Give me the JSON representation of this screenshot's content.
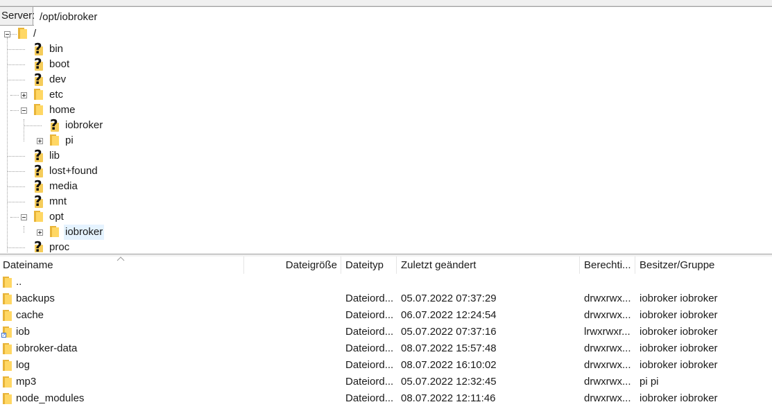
{
  "pathbar": {
    "label": "Server:",
    "value": "/opt/iobroker"
  },
  "tree": {
    "root": "/",
    "nodes": {
      "bin": "bin",
      "boot": "boot",
      "dev": "dev",
      "etc": "etc",
      "home": "home",
      "home_iobroker": "iobroker",
      "home_pi": "pi",
      "lib": "lib",
      "lost_found": "lost+found",
      "media": "media",
      "mnt": "mnt",
      "opt": "opt",
      "opt_iobroker": "iobroker",
      "proc": "proc"
    }
  },
  "list": {
    "columns": {
      "name": "Dateiname",
      "size": "Dateigröße",
      "type": "Dateityp",
      "modified": "Zuletzt geändert",
      "perms": "Berechti...",
      "owner": "Besitzer/Gruppe"
    },
    "rows": [
      {
        "name": "..",
        "size": "",
        "type": "",
        "modified": "",
        "perms": "",
        "owner": ""
      },
      {
        "name": "backups",
        "size": "",
        "type": "Dateiord...",
        "modified": "05.07.2022 07:37:29",
        "perms": "drwxrwx...",
        "owner": "iobroker iobroker"
      },
      {
        "name": "cache",
        "size": "",
        "type": "Dateiord...",
        "modified": "06.07.2022 12:24:54",
        "perms": "drwxrwx...",
        "owner": "iobroker iobroker"
      },
      {
        "name": "iob",
        "size": "",
        "type": "Dateiord...",
        "modified": "05.07.2022 07:37:16",
        "perms": "lrwxrwxr...",
        "owner": "iobroker iobroker"
      },
      {
        "name": "iobroker-data",
        "size": "",
        "type": "Dateiord...",
        "modified": "08.07.2022 15:57:48",
        "perms": "drwxrwx...",
        "owner": "iobroker iobroker"
      },
      {
        "name": "log",
        "size": "",
        "type": "Dateiord...",
        "modified": "08.07.2022 16:10:02",
        "perms": "drwxrwx...",
        "owner": "iobroker iobroker"
      },
      {
        "name": "mp3",
        "size": "",
        "type": "Dateiord...",
        "modified": "05.07.2022 12:32:45",
        "perms": "drwxrwx...",
        "owner": "pi pi"
      },
      {
        "name": "node_modules",
        "size": "",
        "type": "Dateiord...",
        "modified": "08.07.2022 12:11:46",
        "perms": "drwxrwx...",
        "owner": "iobroker iobroker"
      }
    ]
  },
  "icons": {
    "folder": "folder-icon",
    "unknown": "question-mark-icon",
    "symlink": "symlink-folder-icon"
  },
  "colors": {
    "folder_front": "#ffd764",
    "folder_back": "#e8b439",
    "selection": "#e5f3ff"
  }
}
